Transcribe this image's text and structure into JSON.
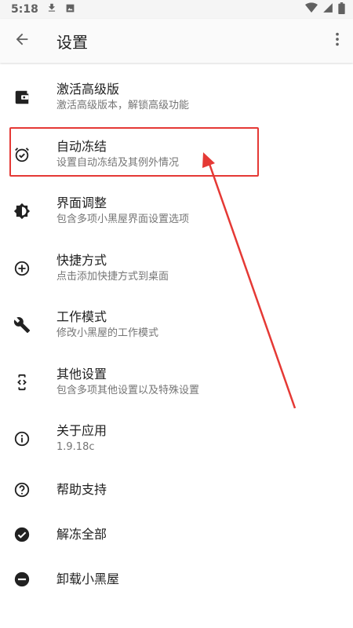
{
  "status_bar": {
    "time": "5:18",
    "icons": [
      "download-icon",
      "photo-icon",
      "wifi-icon",
      "signal-icon",
      "battery-icon"
    ]
  },
  "app_bar": {
    "title": "设置",
    "back_icon": "arrow-back-icon",
    "menu_icon": "more-vert-icon"
  },
  "settings": [
    {
      "icon": "wallet-icon",
      "title": "激活高级版",
      "subtitle": "激活高级版本，解锁高级功能"
    },
    {
      "icon": "alarm-check-icon",
      "title": "自动冻结",
      "subtitle": "设置自动冻结及其例外情况"
    },
    {
      "icon": "brightness-icon",
      "title": "界面调整",
      "subtitle": "包含多项小黑屋界面设置选项"
    },
    {
      "icon": "add-circle-icon",
      "title": "快捷方式",
      "subtitle": "点击添加快捷方式到桌面"
    },
    {
      "icon": "wrench-icon",
      "title": "工作模式",
      "subtitle": "修改小黑屋的工作模式"
    },
    {
      "icon": "developer-mode-icon",
      "title": "其他设置",
      "subtitle": "包含多项其他设置以及特殊设置"
    },
    {
      "icon": "info-icon",
      "title": "关于应用",
      "subtitle": "1.9.18c"
    },
    {
      "icon": "help-icon",
      "title": "帮助支持"
    },
    {
      "icon": "check-circle-icon",
      "title": "解冻全部"
    },
    {
      "icon": "remove-circle-icon",
      "title": "卸载小黑屋"
    }
  ],
  "annotation": {
    "color": "#e53935",
    "highlighted_item": "自动冻结"
  }
}
